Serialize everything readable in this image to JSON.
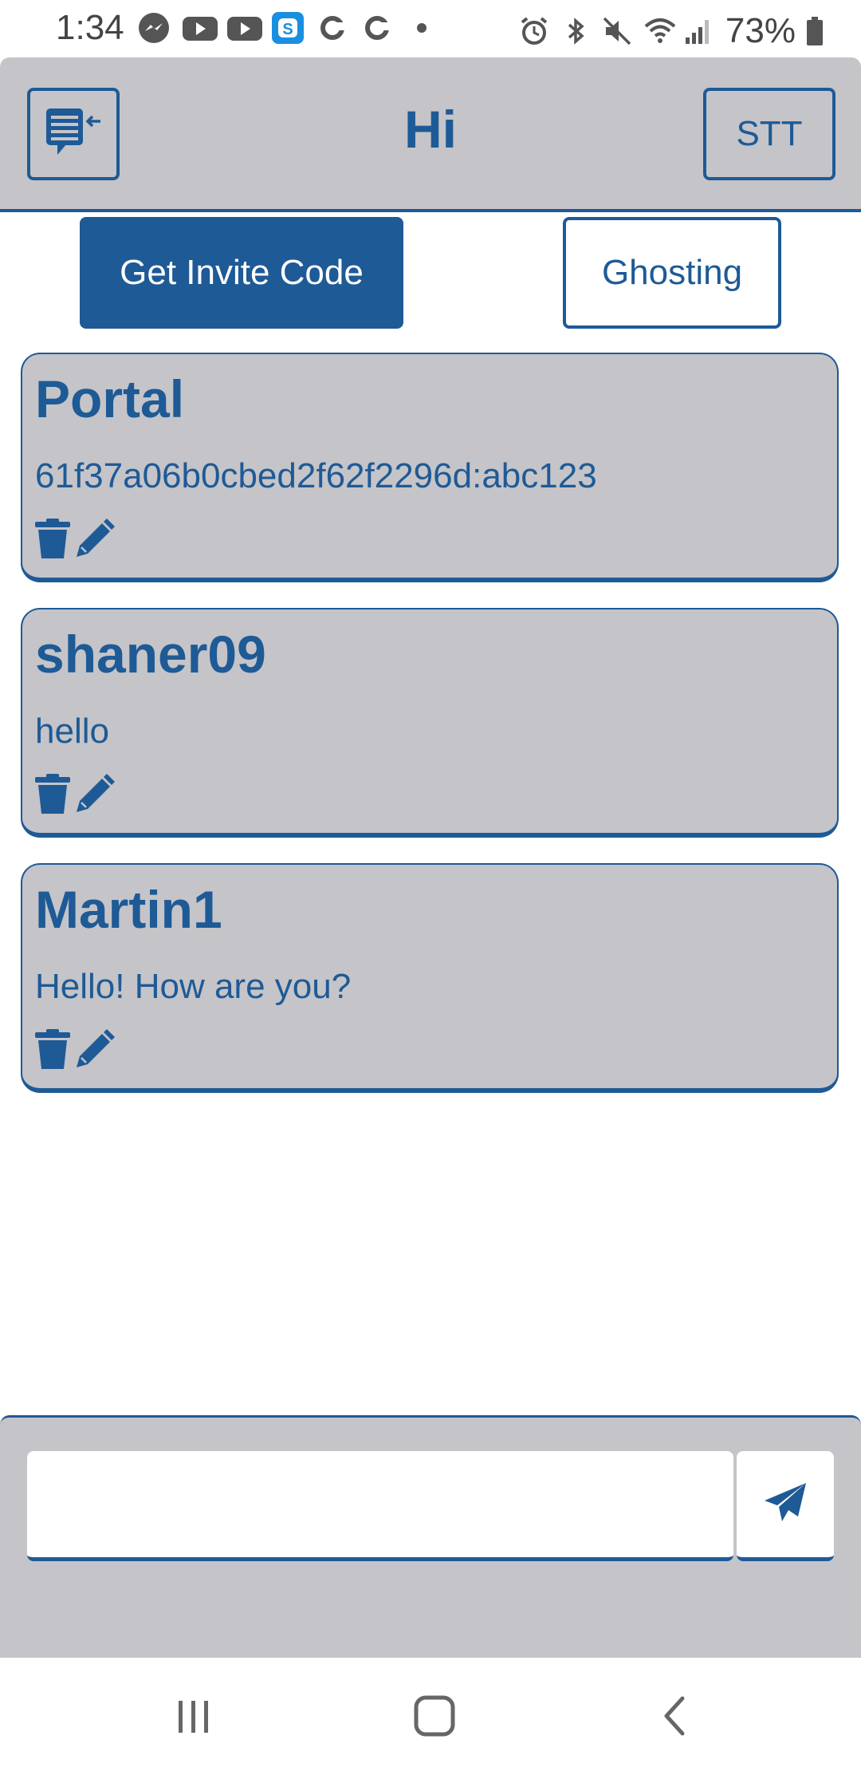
{
  "status_bar": {
    "time": "1:34",
    "battery": "73%",
    "notification_icons": [
      "messenger-icon",
      "youtube-icon",
      "youtube-icon",
      "skype-icon",
      "sync-icon",
      "sync-icon",
      "dot-icon"
    ],
    "system_icons": [
      "alarm-icon",
      "bluetooth-icon",
      "mute-icon",
      "wifi-icon",
      "signal-icon",
      "battery-icon"
    ]
  },
  "header": {
    "title": "Hi",
    "menu_icon": "chat-list-back-icon",
    "stt_label": "STT"
  },
  "actions": {
    "invite_label": "Get Invite Code",
    "ghosting_label": "Ghosting"
  },
  "messages": [
    {
      "name": "Portal",
      "text": "61f37a06b0cbed2f62f2296d:abc123"
    },
    {
      "name": "shaner09",
      "text": "hello"
    },
    {
      "name": "Martin1",
      "text": "Hello! How are you?"
    }
  ],
  "composer": {
    "input_value": "",
    "input_placeholder": "",
    "send_icon": "send-icon"
  },
  "nav": {
    "icons": [
      "recent-apps-icon",
      "home-icon",
      "back-icon"
    ]
  },
  "colors": {
    "primary": "#1e5a96",
    "panel": "#c5c4c8",
    "background": "#ffffff"
  }
}
